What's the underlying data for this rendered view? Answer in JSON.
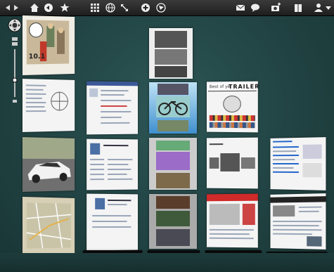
{
  "toolbar": {
    "left_icons": [
      "arrow-left-icon",
      "arrow-right-icon",
      "home-icon",
      "back-circle-icon",
      "star-icon"
    ],
    "center_icons": [
      "grid-icon",
      "globe-icon",
      "expand-icon",
      "add-circle-icon",
      "refresh-circle-icon"
    ],
    "right_icons": [
      "mail-icon",
      "chat-bubble-icon",
      "camera-plus-icon",
      "book-icon",
      "user-icon",
      "dropdown-arrow-icon"
    ]
  },
  "zoom_control": {
    "icons": [
      "navigate-disc-icon",
      "grid-small-icon",
      "zoom-slider",
      "zoom-out-icon"
    ]
  },
  "tiles": {
    "magazine_cover_number": "10.1",
    "trailers_banner": "TRAILER",
    "trailers_prefix": "Best of yel"
  },
  "colors": {
    "background": "#234646",
    "toolbar": "#2a2a2a",
    "highlight_glow": "#2ec6ff"
  }
}
